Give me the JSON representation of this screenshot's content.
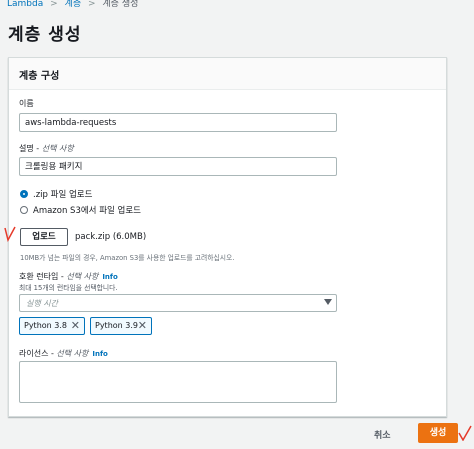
{
  "breadcrumb": {
    "items": [
      "Lambda",
      "계층",
      "계층 생성"
    ]
  },
  "page_title": "계층 생성",
  "panel": {
    "title": "계층 구성",
    "name": {
      "label": "이름",
      "value": "aws-lambda-requests"
    },
    "description": {
      "label": "설명 - ",
      "optional": "선택 사항",
      "value": "크롤링용 패키지"
    },
    "upload_options": [
      {
        "label": ".zip 파일 업로드",
        "selected": true
      },
      {
        "label": "Amazon S3에서 파일 업로드",
        "selected": false
      }
    ],
    "upload_button": "업로드",
    "file_name": "pack.zip (6.0MB)",
    "upload_hint": "10MB가 넘는 파일의 경우, Amazon S3를 사용한 업로드를 고려하십시오.",
    "runtimes": {
      "label": "호환 런타임 - ",
      "optional": "선택 사항",
      "info": "Info",
      "description": "최대 15개의 런타임을 선택합니다.",
      "placeholder": "실행 시간",
      "tokens": [
        "Python 3.8",
        "Python 3.9"
      ]
    },
    "license": {
      "label": "라이선스 - ",
      "optional": "선택 사항",
      "info": "Info",
      "value": ""
    }
  },
  "footer": {
    "cancel_label": "취소",
    "create_label": "생성"
  },
  "colors": {
    "link": "#0073bb",
    "primary": "#ec7211",
    "annotation": "#e53a2a"
  }
}
